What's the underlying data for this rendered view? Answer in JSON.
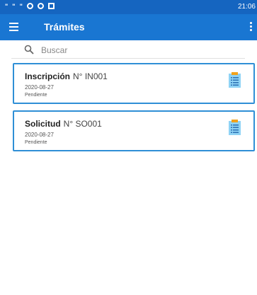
{
  "status_bar": {
    "icons": [
      "notification-quote-icon",
      "notification-quote-icon",
      "notification-quote-icon",
      "record-icon",
      "android-debug-icon",
      "image-icon"
    ],
    "time": "21:06"
  },
  "app_bar": {
    "title": "Trámites",
    "menu_icon": "hamburger-menu-icon",
    "more_icon": "more-vertical-icon"
  },
  "search": {
    "placeholder": "Buscar",
    "value": "",
    "icon": "search-icon"
  },
  "items": [
    {
      "name": "Inscripción",
      "code": "N° IN001",
      "date": "2020-08-27",
      "status": "Pendiente",
      "icon": "clipboard-list-icon"
    },
    {
      "name": "Solicitud",
      "code": "N° SO001",
      "date": "2020-08-27",
      "status": "Pendiente",
      "icon": "clipboard-list-icon"
    }
  ],
  "colors": {
    "status_bar": "#1565c0",
    "app_bar": "#1976d2",
    "card_border": "#2f8fd6",
    "doc_icon_body": "#8fd3f5",
    "doc_icon_top": "#f2a21b",
    "doc_icon_lines": "#2b6fb3"
  }
}
